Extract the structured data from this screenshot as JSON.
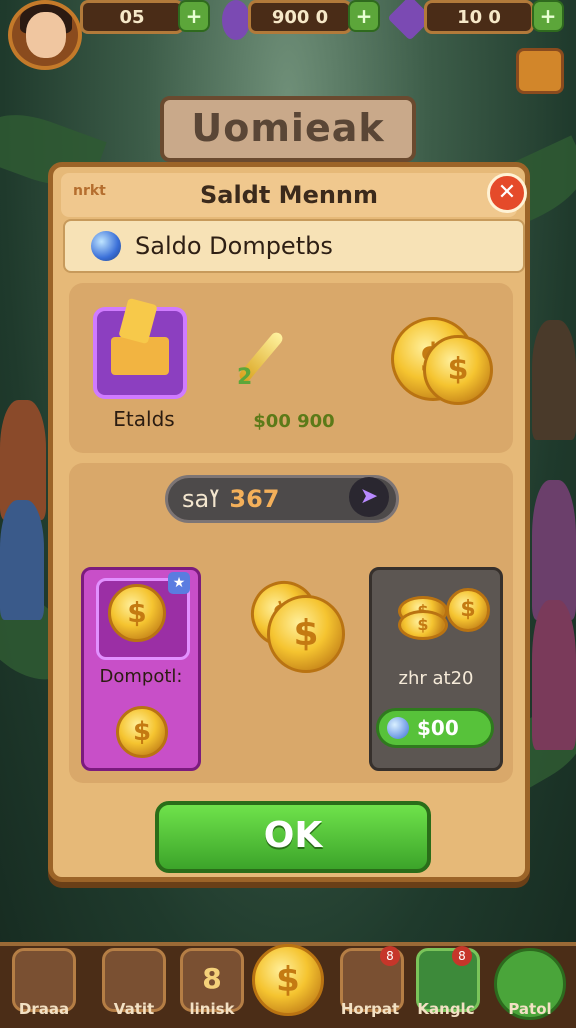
{
  "topbar": {
    "resource1": "05",
    "resource2": "900 0",
    "resource3": "10 0"
  },
  "background_title": "Uomieak",
  "modal": {
    "tag": "nrkt",
    "title": "Saldt Mennm",
    "close": "✕",
    "subtitle": "Saldo Dompetbs",
    "top_panel": {
      "chest_label": "Etalds",
      "amount": "$00 900",
      "key_number": "2"
    },
    "balance": {
      "label": "saߌ",
      "value": "367"
    },
    "card_left": {
      "label": "Dompotl:"
    },
    "card_right": {
      "label": "zhr at20",
      "button_value": "$00"
    },
    "ok_label": "OK"
  },
  "bottom_nav": [
    {
      "label": "Draaa"
    },
    {
      "label": "Vatit"
    },
    {
      "label": "linisk",
      "number": "8"
    },
    {
      "label": ""
    },
    {
      "label": "Horpat",
      "badge": "8"
    },
    {
      "label": "Kanglc",
      "badge": "8"
    },
    {
      "label": "Patol"
    }
  ],
  "colors": {
    "accent_green": "#57c23a",
    "modal_bg": "#e6b978",
    "close_red": "#e54a2a"
  }
}
